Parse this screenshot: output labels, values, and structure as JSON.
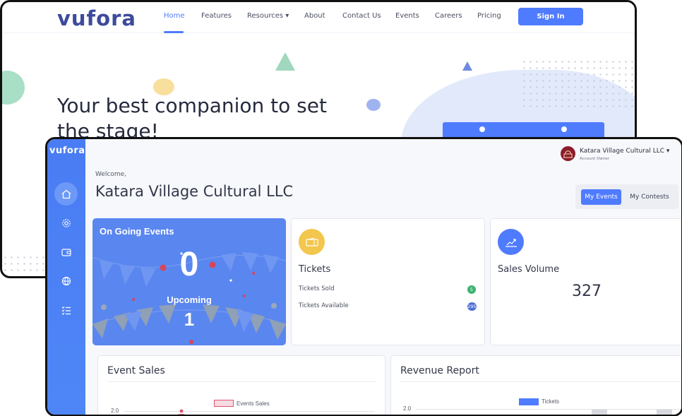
{
  "site": {
    "logo": "vufora",
    "nav": [
      "Home",
      "Features",
      "Resources ▾",
      "About",
      "Contact Us",
      "Events",
      "Careers",
      "Pricing"
    ],
    "signin_label": "Sign In",
    "hero_title": "Your best companion to set the stage!"
  },
  "dashboard": {
    "logo": "vufora",
    "account": {
      "name": "Katara Village Cultural LLC ▾",
      "role": "Account Owner"
    },
    "welcome": "Welcome,",
    "org_title": "Katara Village Cultural LLC",
    "tabs": {
      "active": "My Events",
      "other": "My Contests"
    },
    "sidebar_icons": [
      "home-icon",
      "settings-icon",
      "wallet-icon",
      "globe-icon",
      "checklist-icon"
    ],
    "ongoing": {
      "title": "On Going Events",
      "count": "0",
      "upcoming_label": "Upcoming",
      "upcoming_count": "1"
    },
    "tickets": {
      "title": "Tickets",
      "sold_label": "Tickets Sold",
      "sold_value": "5",
      "available_label": "Tickets Available",
      "available_value": "295"
    },
    "sales": {
      "title": "Sales Volume",
      "value": "327"
    },
    "event_sales": {
      "title": "Event Sales",
      "legend": "Events Sales",
      "y_tick": "2.0"
    },
    "revenue": {
      "title": "Revenue Report",
      "legend": "Tickets",
      "y_tick": "2.0"
    }
  },
  "colors": {
    "primary": "#4f7bff",
    "sidebar": "#4a7cf3",
    "badge_green": "#3cb371",
    "badge_blue": "#4f6fd6",
    "ticket_icon": "#f3c64e",
    "sales_icon": "#4f7bff",
    "chart_red": "#e0566e"
  }
}
